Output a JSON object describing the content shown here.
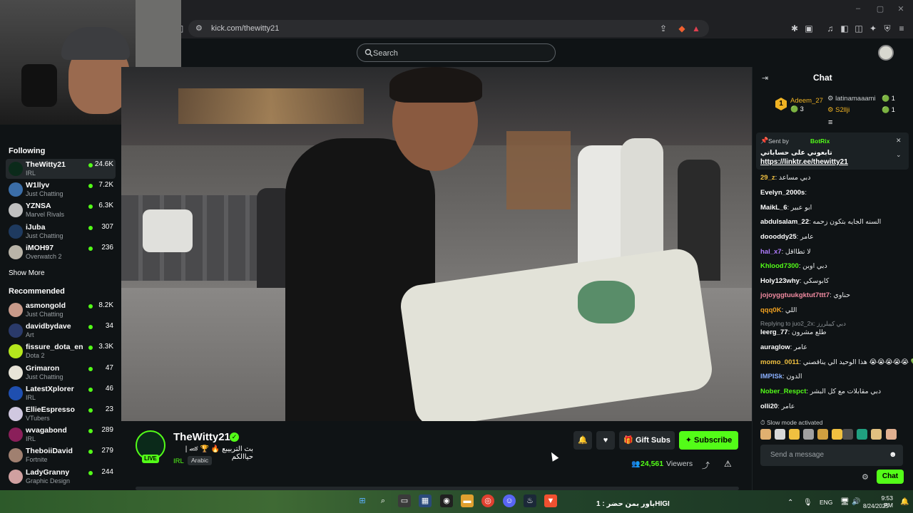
{
  "browser": {
    "url": "kick.com/thewitty21",
    "window_controls": [
      "–",
      "▢",
      "✕"
    ]
  },
  "header": {
    "search_placeholder": "Search"
  },
  "sidebar": {
    "following_label": "Following",
    "following": [
      {
        "name": "TheWitty21",
        "category": "IRL",
        "viewers": "24.6K",
        "avatar_color": "#0b2a1a",
        "active": true
      },
      {
        "name": "W1llyv",
        "category": "Just Chatting",
        "viewers": "7.2K",
        "avatar_color": "#3b6ea8"
      },
      {
        "name": "YZNSA",
        "category": "Marvel Rivals",
        "viewers": "6.3K",
        "avatar_color": "#c0c0c0"
      },
      {
        "name": "iJuba",
        "category": "Just Chatting",
        "viewers": "307",
        "avatar_color": "#1e3a5f"
      },
      {
        "name": "iMOH97",
        "category": "Overwatch 2",
        "viewers": "236",
        "avatar_color": "#b9b4a8"
      }
    ],
    "show_more_label": "Show More",
    "recommended_label": "Recommended",
    "recommended": [
      {
        "name": "asmongold",
        "category": "Just Chatting",
        "viewers": "8.2K",
        "avatar_color": "#c89a8a"
      },
      {
        "name": "davidbydave",
        "category": "Art",
        "viewers": "34",
        "avatar_color": "#2a3a6a"
      },
      {
        "name": "fissure_dota_en",
        "category": "Dota 2",
        "viewers": "3.3K",
        "avatar_color": "#b5e61d"
      },
      {
        "name": "Grimaron",
        "category": "Just Chatting",
        "viewers": "47",
        "avatar_color": "#e8e4d8"
      },
      {
        "name": "LatestXplorer",
        "category": "IRL",
        "viewers": "46",
        "avatar_color": "#1f4fb0"
      },
      {
        "name": "EllieEspresso",
        "category": "VTubers",
        "viewers": "23",
        "avatar_color": "#d0c8e0"
      },
      {
        "name": "wvagabond",
        "category": "IRL",
        "viewers": "289",
        "avatar_color": "#8a1f5a"
      },
      {
        "name": "TheboiiDavid",
        "category": "Fortnite",
        "viewers": "279",
        "avatar_color": "#a08070"
      },
      {
        "name": "LadyGranny",
        "category": "Graphic Design",
        "viewers": "244",
        "avatar_color": "#d0a0a0"
      }
    ]
  },
  "channel": {
    "name": "TheWitty21",
    "title": "بث التربيبع 🔥 🏆 🏎 | حياالكم",
    "category": "IRL",
    "language": "Arabic",
    "live_label": "LIVE",
    "viewers": "24,561",
    "viewers_label": "Viewers",
    "gift_label": "Gift Subs",
    "subscribe_label": "Subscribe"
  },
  "chat": {
    "title": "Chat",
    "leaderboard": [
      {
        "name": "Adeem_27",
        "count": "3",
        "rank": "1"
      },
      {
        "name": "latinamaaami",
        "count": "1"
      },
      {
        "name": "S2llji",
        "count": "1"
      }
    ],
    "pinned": {
      "sent_by_label": "Sent by",
      "bot": "BotRix",
      "message": "تابعوني على حساباتي",
      "link": "https://linktr.ee/thewitty21"
    },
    "messages": [
      {
        "user": "29_z",
        "text": "دبي مساعد",
        "color": "#f0c040"
      },
      {
        "user": "Evelyn_2000s",
        "text": "",
        "color": "#ffffff"
      },
      {
        "user": "MaikL_6",
        "text": "ابو عبير",
        "color": "#ffffff"
      },
      {
        "user": "abdulsalam_22",
        "text": "السنه الجايه بتكون زحمه",
        "color": "#ffffff"
      },
      {
        "user": "doooddy25",
        "text": "عامر",
        "color": "#ffffff"
      },
      {
        "user": "hal_x7",
        "text": "لا تطااقل",
        "color": "#b07cff"
      },
      {
        "user": "Khlood7300",
        "text": "دبي اوبن",
        "color": "#53fc18"
      },
      {
        "user": "Holy123why",
        "text": "كابوسكي",
        "color": "#ffffff"
      },
      {
        "user": "jojoyggtuukgktut7ttt7",
        "text": "حناوي",
        "color": "#f08aa0"
      },
      {
        "user": "qqq0K",
        "text": "اللي",
        "color": "#f0a020"
      },
      {
        "user": "leerg_77",
        "text": "طلع مشرون",
        "color": "#ffffff"
      },
      {
        "user": "auraglow",
        "text": "عامر",
        "color": "#ffffff"
      },
      {
        "user": "momo_0011",
        "text": "هذا الوحيد الي يناقصني 😭😭😭😭😭 💚",
        "color": "#f0c040"
      },
      {
        "user": "IMPISk",
        "text": "الدون",
        "color": "#8ab0ff"
      },
      {
        "user": "Nober_Respct",
        "text": "دبي مقابلات مع كل البشر",
        "color": "#53fc18"
      },
      {
        "user": "olli20",
        "text": "عامر",
        "color": "#ffffff"
      }
    ],
    "reply_label": "Replying to juo2_2x: دبي كيبلررز",
    "slow_mode": "Slow mode activated",
    "input_placeholder": "Send a message",
    "send_label": "Chat"
  },
  "taskbar": {
    "ticker": "باور بمن حضر : 1HIGI",
    "lang": "ENG",
    "time": "9:53 PM",
    "date": "8/24/2025"
  }
}
